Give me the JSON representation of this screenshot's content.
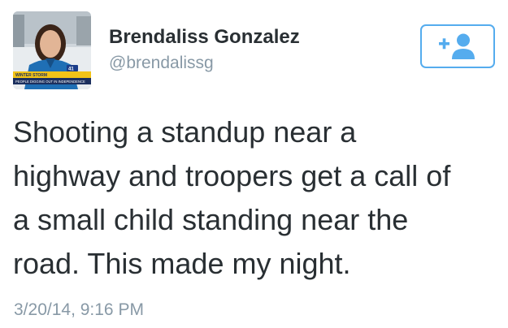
{
  "author": {
    "display_name": "Brendaliss Gonzalez",
    "handle": "@brendalissg",
    "avatar_banner": "PEOPLE DIGGING OUT IN INDEPENDENCE",
    "avatar_tag": "WINTER STORM",
    "avatar_logo": "41"
  },
  "follow_button": {
    "icon": "follow-user-plus-icon",
    "color": "#55acee"
  },
  "tweet": {
    "text_lines": [
      "Shooting a standup near a",
      "highway and troopers get a call of",
      "a small child standing near the",
      "road. This made my night."
    ],
    "timestamp": "3/20/14, 9:16 PM"
  }
}
